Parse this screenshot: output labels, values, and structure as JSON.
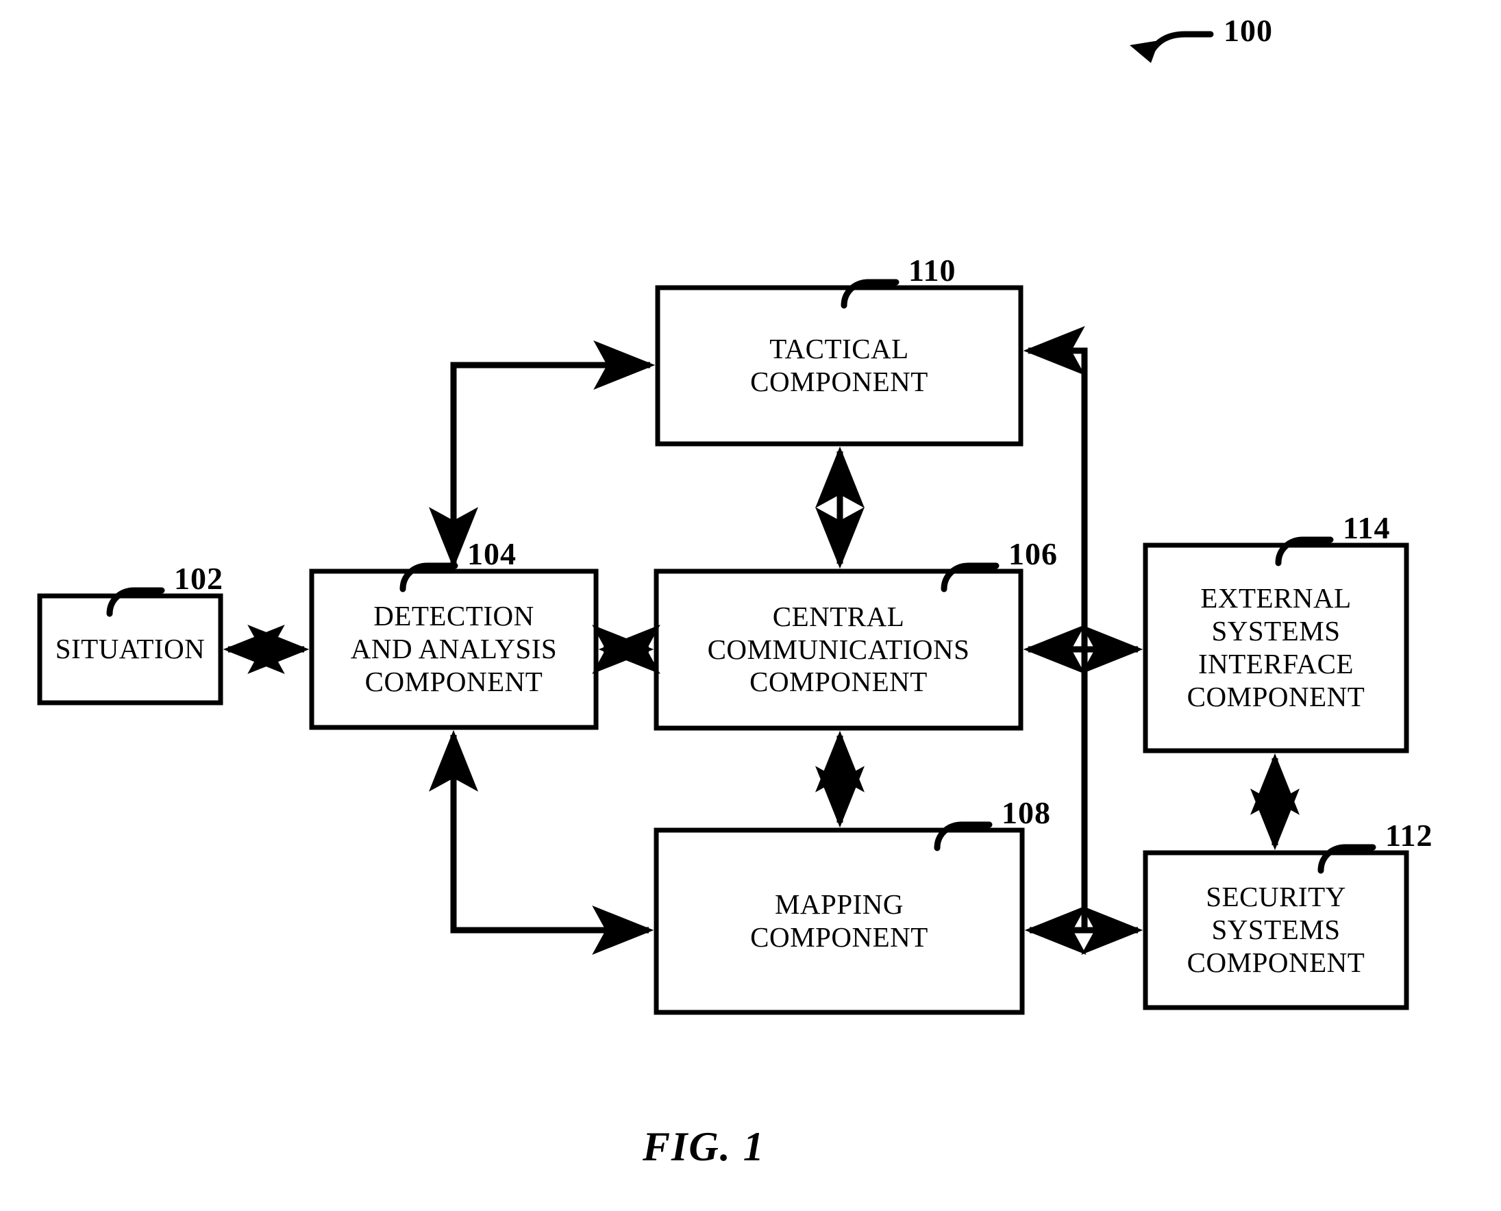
{
  "figure": {
    "caption": "FIG. 1",
    "system_ref": "100"
  },
  "boxes": [
    {
      "id": "situation",
      "ref": "102",
      "lines": [
        "SITUATION"
      ]
    },
    {
      "id": "detection",
      "ref": "104",
      "lines": [
        "DETECTION",
        "AND ANALYSIS",
        "COMPONENT"
      ]
    },
    {
      "id": "central",
      "ref": "106",
      "lines": [
        "CENTRAL",
        "COMMUNICATIONS",
        "COMPONENT"
      ]
    },
    {
      "id": "mapping",
      "ref": "108",
      "lines": [
        "MAPPING",
        "COMPONENT"
      ]
    },
    {
      "id": "tactical",
      "ref": "110",
      "lines": [
        "TACTICAL",
        "COMPONENT"
      ]
    },
    {
      "id": "security",
      "ref": "112",
      "lines": [
        "SECURITY",
        "SYSTEMS",
        "COMPONENT"
      ]
    },
    {
      "id": "external",
      "ref": "114",
      "lines": [
        "EXTERNAL",
        "SYSTEMS",
        "INTERFACE",
        "COMPONENT"
      ]
    }
  ],
  "connections": [
    {
      "from": "situation",
      "to": "detection",
      "style": "double-arrow"
    },
    {
      "from": "detection",
      "to": "central",
      "style": "double-arrow"
    },
    {
      "from": "central",
      "to": "external",
      "style": "double-arrow"
    },
    {
      "from": "tactical",
      "to": "central",
      "style": "double-arrow"
    },
    {
      "from": "central",
      "to": "mapping",
      "style": "double-arrow"
    },
    {
      "from": "mapping",
      "to": "security",
      "style": "double-arrow"
    },
    {
      "from": "external",
      "to": "security",
      "style": "double-arrow"
    },
    {
      "from": "tactical",
      "to": "detection",
      "style": "elbow-arrow"
    },
    {
      "from": "mapping",
      "to": "detection",
      "style": "elbow-arrow"
    },
    {
      "from": "security",
      "to": "tactical",
      "style": "elbow-arrow"
    }
  ]
}
